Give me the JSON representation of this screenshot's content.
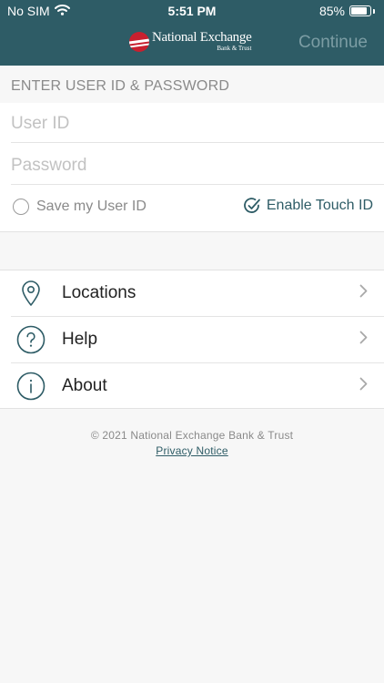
{
  "status_bar": {
    "carrier": "No SIM",
    "time": "5:51 PM",
    "battery": "85%",
    "battery_level": 0.85
  },
  "header": {
    "logo_name": "National Exchange",
    "logo_sub": "Bank & Trust",
    "continue_label": "Continue"
  },
  "login": {
    "section_label": "ENTER USER ID & PASSWORD",
    "user_id_placeholder": "User ID",
    "password_placeholder": "Password",
    "save_user_id_label": "Save my User ID",
    "touch_id_label": "Enable Touch ID"
  },
  "menu": {
    "items": [
      {
        "label": "Locations",
        "icon": "location-pin-icon"
      },
      {
        "label": "Help",
        "icon": "question-icon"
      },
      {
        "label": "About",
        "icon": "info-icon"
      }
    ]
  },
  "footer": {
    "copyright": "© 2021 National Exchange Bank & Trust",
    "privacy_label": "Privacy Notice"
  },
  "colors": {
    "header_bg": "#2e5c66",
    "accent": "#2e5c66",
    "brand_red": "#c8202f"
  }
}
